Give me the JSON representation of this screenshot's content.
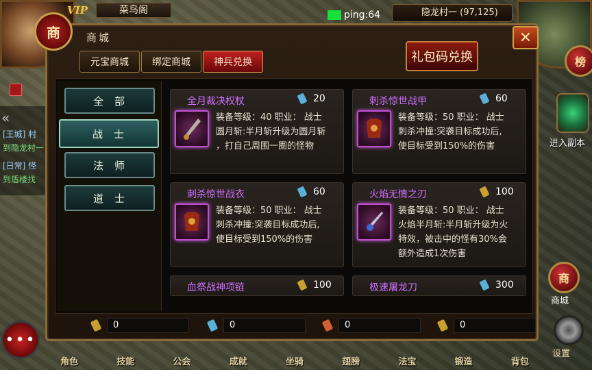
{
  "hud": {
    "vip": "VIP",
    "player_name": "菜鸟阁",
    "ping": "ping:64",
    "location": "隐龙村一 (97,125)",
    "chat_lines": [
      "[王城] 村",
      "到隐龙村一",
      "[日常] 怪",
      "到盾楼找"
    ]
  },
  "side": {
    "rank_label": "榜",
    "dungeon_label": "进入副本",
    "shop_label": "商城",
    "settings_label": "设置",
    "shop_icon_char": "商",
    "chat_btn": "•••"
  },
  "bottom_nav": [
    "角色",
    "技能",
    "公会",
    "成就",
    "坐骑",
    "翅膀",
    "法宝",
    "锻造",
    "背包"
  ],
  "shop": {
    "badge": "商",
    "title": "商城",
    "close": "✕",
    "tabs": [
      "元宝商城",
      "绑定商城",
      "神兵兑换"
    ],
    "active_tab": 2,
    "redeem_button": "礼包码兑换",
    "categories": [
      "全部",
      "战士",
      "法师",
      "道士"
    ],
    "active_category": 1,
    "items": [
      {
        "name": "全月裁决权杖",
        "price": "20",
        "currency_color": "#5ab0d8",
        "desc": [
          "装备等级：40  职业： 战士",
          "圆月斩:半月斩升级为圆月斩",
          "，打自己周围一圈的怪物"
        ]
      },
      {
        "name": "刺杀惊世战甲",
        "price": "60",
        "currency_color": "#5ab0d8",
        "desc": [
          "装备等级：50  职业： 战士",
          "刺杀冲撞:突袭目标成功后,",
          "使目标受到150%的伤害"
        ]
      },
      {
        "name": "刺杀惊世战衣",
        "price": "60",
        "currency_color": "#5ab0d8",
        "desc": [
          "装备等级：50  职业： 战士",
          "刺杀冲撞:突袭目标成功后,",
          "使目标受到150%的伤害"
        ]
      },
      {
        "name": "火焰无情之刃",
        "price": "100",
        "currency_color": "#c8a030",
        "desc": [
          "装备等级：50  职业： 战士",
          "火焰半月斩:半月斩升级为火",
          "特效，被击中的怪有30%会",
          "额外造成1次伤害"
        ]
      },
      {
        "name": "血祭战神项链",
        "price": "100",
        "currency_color": "#c8a030",
        "desc": []
      },
      {
        "name": "极速屠龙刀",
        "price": "300",
        "currency_color": "#5ab0d8",
        "desc": []
      }
    ],
    "balances": [
      {
        "value": "0",
        "color": "#c8a030"
      },
      {
        "value": "0",
        "color": "#5ab0d8"
      },
      {
        "value": "0",
        "color": "#d06030"
      },
      {
        "value": "0",
        "color": "#c8a030"
      }
    ]
  }
}
